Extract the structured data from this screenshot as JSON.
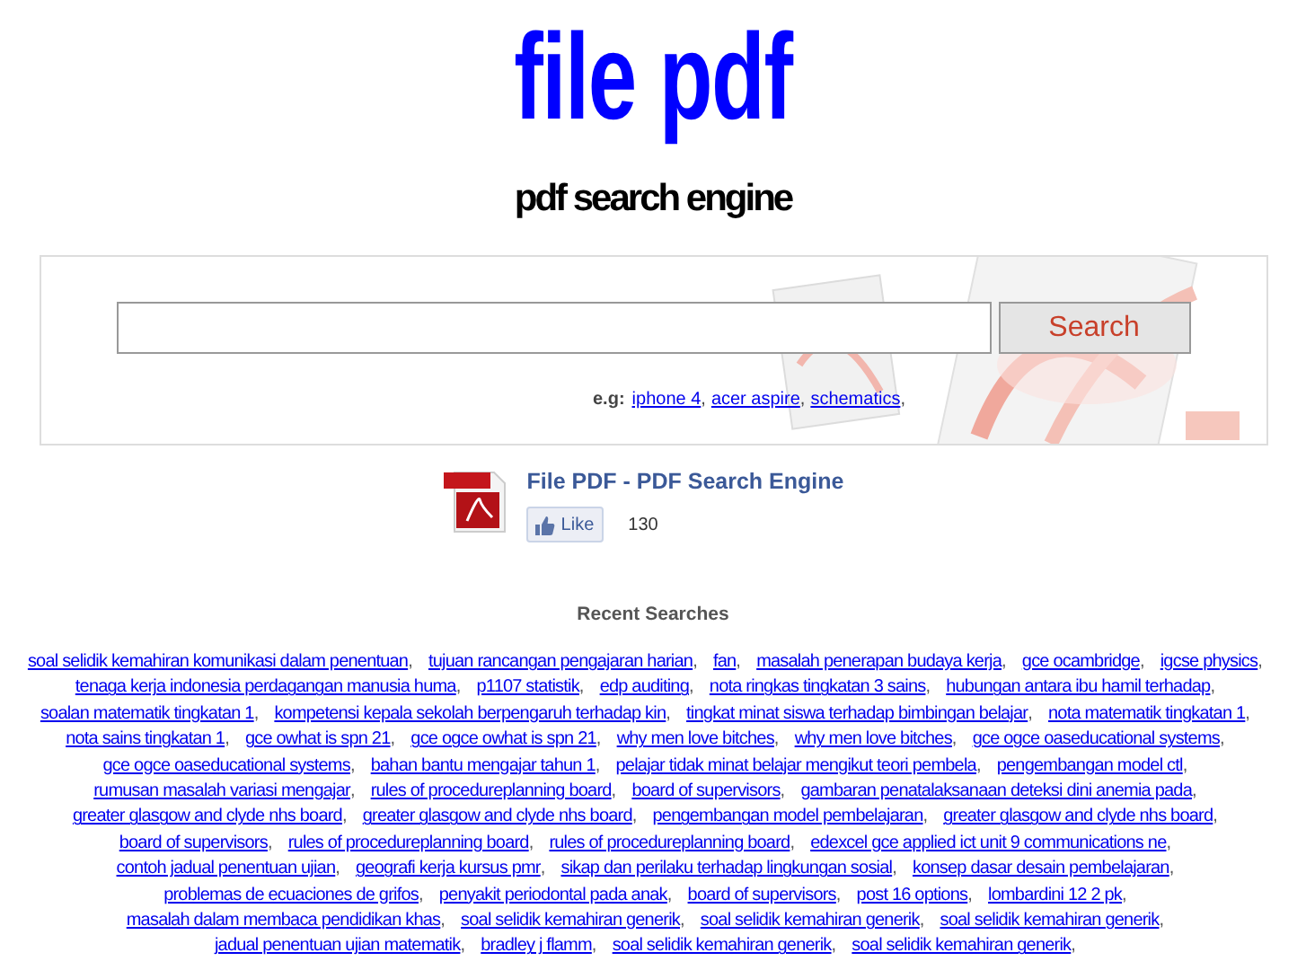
{
  "logo": "file pdf",
  "tagline": "pdf search engine",
  "search": {
    "button": "Search",
    "examples_label": "e.g:",
    "examples": [
      "iphone 4",
      "acer aspire",
      "schematics"
    ],
    "separator": ","
  },
  "facebook": {
    "title": "File PDF - PDF Search Engine",
    "like": "Like",
    "count": "130"
  },
  "recent": {
    "title": "Recent Searches",
    "separator": ",",
    "links": [
      "soal selidik kemahiran komunikasi dalam penentuan",
      "tujuan rancangan pengajaran harian",
      "fan",
      "masalah penerapan budaya kerja",
      "gce ocambridge",
      "igcse physics",
      "tenaga kerja indonesia perdagangan manusia huma",
      "p1107 statistik",
      "edp auditing",
      "nota ringkas tingkatan 3 sains",
      "hubungan antara ibu hamil terhadap",
      "soalan matematik tingkatan 1",
      "kompetensi kepala sekolah berpengaruh terhadap kin",
      "tingkat minat siswa terhadap bimbingan belajar",
      "nota matematik tingkatan 1",
      "nota sains tingkatan 1",
      "gce owhat is spn 21",
      "gce ogce owhat is spn 21",
      "why men love bitches",
      "why men love bitches",
      "gce ogce oaseducational systems",
      "gce ogce oaseducational systems",
      "bahan bantu mengajar tahun 1",
      "pelajar tidak minat belajar mengikut teori pembela",
      "pengembangan model ctl",
      "rumusan masalah variasi mengajar",
      "rules of procedureplanning board",
      "board of supervisors",
      "gambaran penatalaksanaan deteksi dini anemia pada",
      "greater glasgow and clyde nhs board",
      "greater glasgow and clyde nhs board",
      "pengembangan model pembelajaran",
      "greater glasgow and clyde nhs board",
      "board of supervisors",
      "rules of procedureplanning board",
      "rules of procedureplanning board",
      "edexcel gce applied ict unit 9 communications ne",
      "contoh jadual penentuan ujian",
      "geografi kerja kursus pmr",
      "sikap dan perilaku terhadap lingkungan sosial",
      "konsep dasar desain pembelajaran",
      "problemas de ecuaciones de grifos",
      "penyakit periodontal pada anak",
      "board of supervisors",
      "post 16 options",
      "lombardini 12 2 pk",
      "masalah dalam membaca pendidikan khas",
      "soal selidik kemahiran generik",
      "soal selidik kemahiran generik",
      "soal selidik kemahiran generik",
      "jadual penentuan ujian matematik",
      "bradley j flamm",
      "soal selidik kemahiran generik",
      "soal selidik kemahiran generik"
    ]
  }
}
